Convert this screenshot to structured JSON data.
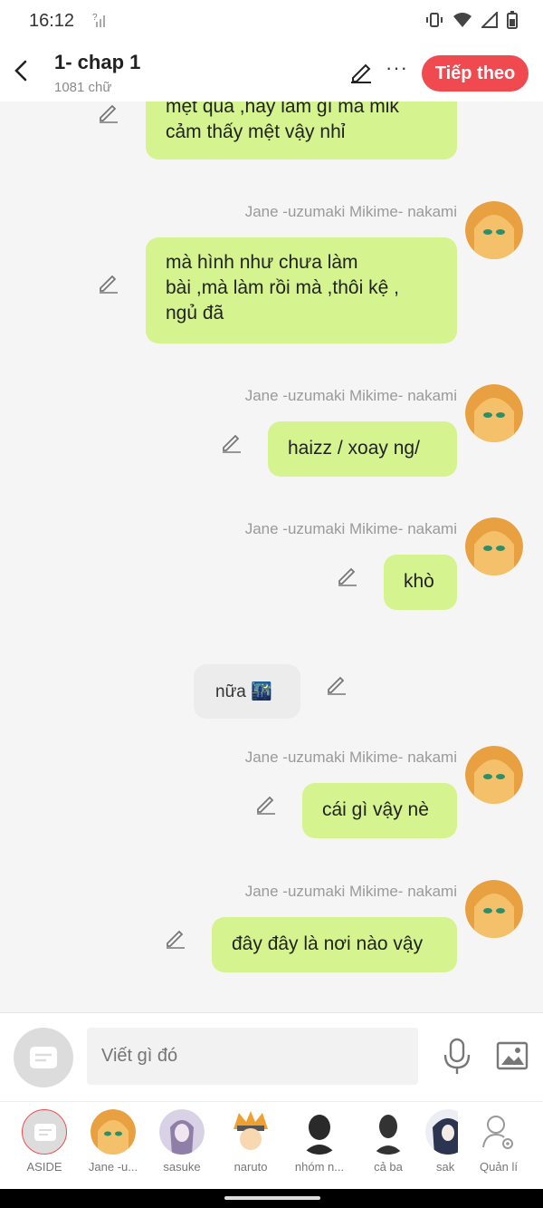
{
  "status_bar": {
    "time": "16:12",
    "signal": "?",
    "icons": [
      "vibrate-icon",
      "wifi-icon",
      "signal-icon",
      "battery-icon"
    ]
  },
  "header": {
    "title": "1- chap 1",
    "word_count": "1081 chữ",
    "next_label": "Tiếp theo",
    "more_label": "···",
    "accent": "#f04a50"
  },
  "messages": [
    {
      "type": "right",
      "name": "",
      "text_lines": [
        "mệt quá ,hây làm gì mà mik",
        "cảm thấy mệt vậy nhỉ"
      ]
    },
    {
      "type": "right",
      "name": "Jane -uzumaki Mikime- nakami",
      "text_lines": [
        "mà hình như chưa làm",
        "bài ,mà làm rồi mà ,thôi kệ ,",
        "ngủ đã"
      ]
    },
    {
      "type": "right",
      "name": "Jane -uzumaki Mikime- nakami",
      "text_lines": [
        "haizz / xoay ng/"
      ]
    },
    {
      "type": "right",
      "name": "Jane -uzumaki Mikime- nakami",
      "text_lines": [
        "khò"
      ]
    },
    {
      "type": "center",
      "name": "",
      "text_lines": [
        "nữa 🌃"
      ]
    },
    {
      "type": "right",
      "name": "Jane -uzumaki Mikime- nakami",
      "text_lines": [
        "cái gì vậy nè"
      ]
    },
    {
      "type": "right",
      "name": "Jane -uzumaki Mikime- nakami",
      "text_lines": [
        "đây đây là nơi nào vậy"
      ]
    }
  ],
  "input": {
    "placeholder": "Viết gì đó"
  },
  "characters": [
    {
      "label": "ASIDE",
      "color": "#dcdcdc"
    },
    {
      "label": "Jane -u...",
      "color": "#e8a040"
    },
    {
      "label": "sasuke",
      "color": "#8f7fa8"
    },
    {
      "label": "naruto",
      "color": "#f0a030"
    },
    {
      "label": "nhóm n...",
      "color": "#2a2a2a"
    },
    {
      "label": "cả ba",
      "color": "#333333"
    },
    {
      "label": "sak",
      "color": "#2b3550"
    },
    {
      "label": "Quản lí",
      "color": "#ffffff"
    }
  ],
  "colors": {
    "bubble": "#d5f38e",
    "background": "#f5f5f5"
  }
}
